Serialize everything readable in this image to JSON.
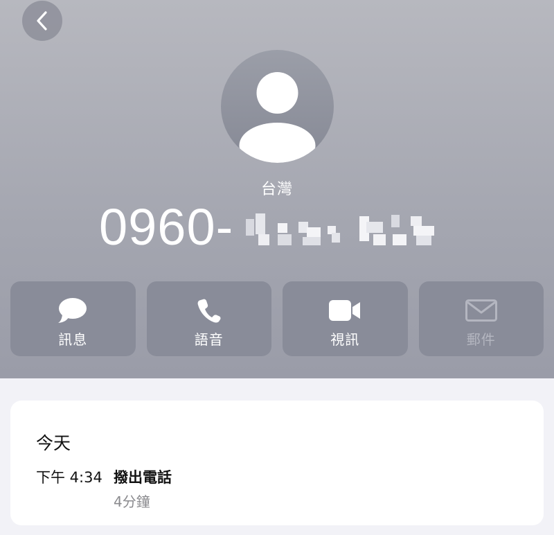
{
  "header": {
    "location": "台灣",
    "phone_prefix": "0960-",
    "colors": {
      "header_top": "#b7b8bf",
      "header_bottom": "#9a9ca8",
      "action_bg": "#898c99",
      "text_on_header": "#ffffff"
    }
  },
  "actions": [
    {
      "label": "訊息",
      "icon": "message-bubble-icon",
      "enabled": true
    },
    {
      "label": "語音",
      "icon": "phone-icon",
      "enabled": true
    },
    {
      "label": "視訊",
      "icon": "video-camera-icon",
      "enabled": true
    },
    {
      "label": "郵件",
      "icon": "envelope-icon",
      "enabled": false
    }
  ],
  "history": {
    "date_heading": "今天",
    "entries": [
      {
        "time": "下午 4:34",
        "type": "撥出電話",
        "duration": "4分鐘"
      }
    ]
  }
}
